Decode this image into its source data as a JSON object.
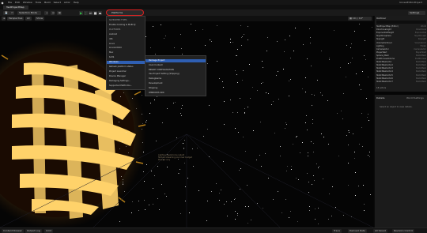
{
  "menubar": {
    "items": [
      "File",
      "Edit",
      "Window",
      "Tools",
      "Build",
      "Select",
      "Actor",
      "Help"
    ],
    "project": "UnrealEditorProject"
  },
  "tabs": [
    "TestProjectMap"
  ],
  "toolbar": {
    "save_label": "Save",
    "mode_label": "Selection Mode",
    "platforms_label": "Platforms",
    "settings_label": "Settings"
  },
  "viewport": {
    "perspective_label": "Perspective",
    "lit_label": "Lit",
    "show_label": "Show",
    "notice_lines": [
      "Lighting needs to be rebuilt",
      "Texture streaming pool over budget",
      "Preview only"
    ]
  },
  "platforms_menu": {
    "items": [
      {
        "label": "SUPPORTED TYPES",
        "kind": "head"
      },
      {
        "label": "Enable Cooking & Multi-Ty",
        "kind": "item"
      },
      {
        "label": "PLATFORMS",
        "kind": "head"
      },
      {
        "label": "Android",
        "kind": "item"
      },
      {
        "label": "iOS",
        "kind": "item"
      },
      {
        "label": "Linux",
        "kind": "item"
      },
      {
        "label": "LinuxArm64",
        "kind": "item"
      },
      {
        "label": "Mac",
        "kind": "item"
      },
      {
        "label": "tvOS",
        "kind": "item"
      },
      {
        "label": "Windows",
        "kind": "selected"
      },
      {
        "label": "Refresh platform status",
        "kind": "item"
      },
      {
        "label": "Project Launcher",
        "kind": "item"
      },
      {
        "label": "Device Manager",
        "kind": "item"
      },
      {
        "label": "Packaging Settings...",
        "kind": "item"
      },
      {
        "label": "Supported Platforms...",
        "kind": "item"
      }
    ]
  },
  "windows_submenu": {
    "items": [
      {
        "label": "Package Project",
        "kind": "selected"
      },
      {
        "label": "Cook Content",
        "kind": "item"
      },
      {
        "label": "BINARY CONFIGURATION",
        "kind": "head"
      },
      {
        "label": "Use Project Setting (Shipping)",
        "kind": "item"
      },
      {
        "label": "DebugGame",
        "kind": "item"
      },
      {
        "label": "Development",
        "kind": "item"
      },
      {
        "label": "Shipping",
        "kind": "item"
      },
      {
        "label": "WINDOWS SDK",
        "kind": "head"
      }
    ]
  },
  "outliner": {
    "title": "Outliner",
    "rows": [
      {
        "name": "TestProjectMap (Editor)",
        "type": "World"
      },
      {
        "name": "DirectionalLight",
        "type": "Directional"
      },
      {
        "name": "ExponentialHeight",
        "type": "Exponential"
      },
      {
        "name": "SkyAtmosphere",
        "type": "SkyAtmosph"
      },
      {
        "name": "SkyLight",
        "type": "SkyLight"
      },
      {
        "name": "VolumetricCloud",
        "type": "VolumetricC"
      },
      {
        "name": "Lighting",
        "type": "Folder"
      },
      {
        "name": "CameraActor",
        "type": "CameraActor"
      },
      {
        "name": "PlayerStart",
        "type": "PlayerStart"
      },
      {
        "name": "Sphere_Mesh",
        "type": "StaticMesh"
      },
      {
        "name": "PostProcessVolume",
        "type": "PostProcess"
      },
      {
        "name": "StaticMeshActor",
        "type": "StaticMesh"
      },
      {
        "name": "StaticMeshActor2",
        "type": "StaticMesh"
      },
      {
        "name": "StaticMeshActor3",
        "type": "StaticMesh"
      },
      {
        "name": "StaticMeshActor4",
        "type": "StaticMesh"
      },
      {
        "name": "StaticMeshActor5",
        "type": "StaticMesh"
      },
      {
        "name": "StaticMeshActor6",
        "type": "StaticMesh"
      },
      {
        "name": "StaticMeshActor7",
        "type": "StaticMesh"
      }
    ],
    "count": "18 actors"
  },
  "details": {
    "title": "Details",
    "tab2": "World Settings",
    "empty_msg": "Select an object to view details."
  },
  "statusbar": {
    "content_drawer": "Content Drawer",
    "output_log": "Output Log",
    "cmd": "Cmd",
    "trace": "Trace",
    "derived_data": "Derived Data",
    "all_saved": "All Saved",
    "revision": "Revision Control"
  },
  "colors": {
    "accent": "#2f5fb3",
    "highlight_ring": "#dd2222",
    "glow": "#ffd26a"
  }
}
